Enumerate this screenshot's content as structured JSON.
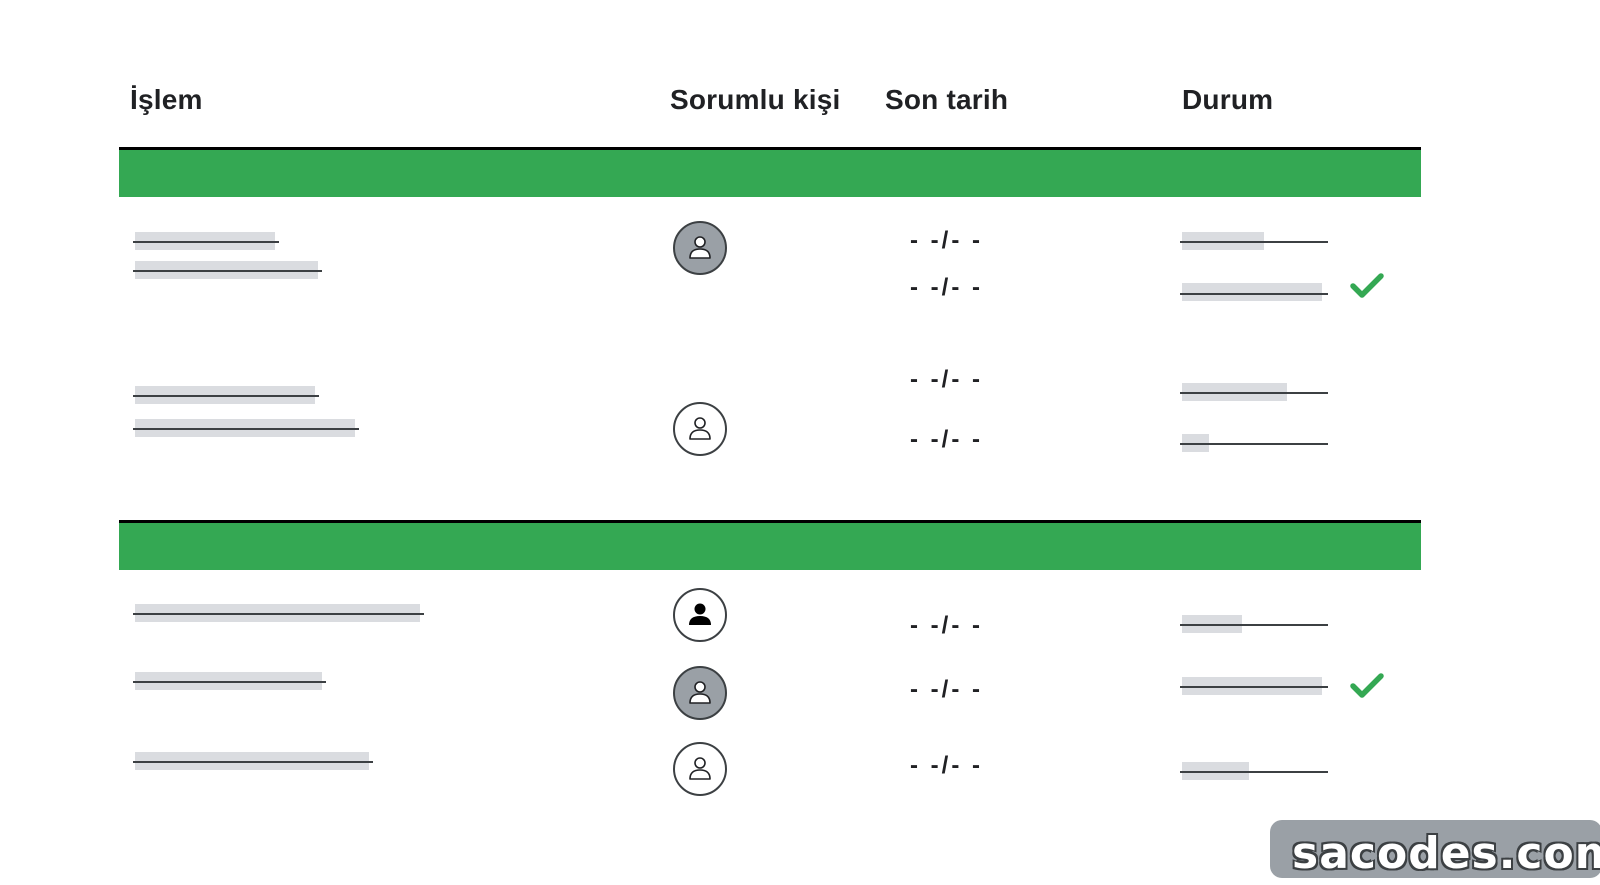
{
  "table": {
    "headers": {
      "action": "İşlem",
      "owner": "Sorumlu kişi",
      "due": "Son tarih",
      "status": "Durum"
    },
    "date_placeholder": "- -/- -"
  },
  "groups": [
    {
      "rows": [
        {
          "avatar": "person-icon",
          "avatar_style": "grey",
          "dates": [
            "- -/- -",
            "- -/- -"
          ],
          "status": [
            "in-progress",
            "done"
          ]
        },
        {
          "avatar": "person-icon",
          "avatar_style": "outline",
          "dates": [
            "- -/- -",
            "- -/- -"
          ],
          "status": [
            "in-progress",
            "in-progress"
          ]
        }
      ]
    },
    {
      "rows": [
        {
          "avatar": "person-icon",
          "avatar_style": "filled-black",
          "dates": [
            "- -/- -"
          ],
          "status": [
            "in-progress"
          ]
        },
        {
          "avatar": "person-icon",
          "avatar_style": "grey",
          "dates": [
            "- -/- -"
          ],
          "status": [
            "done"
          ]
        },
        {
          "avatar": "person-icon",
          "avatar_style": "outline",
          "dates": [
            "- -/- -"
          ],
          "status": [
            "in-progress"
          ]
        }
      ]
    }
  ],
  "colors": {
    "band": "#34a853",
    "check": "#34a853",
    "placeholder": "#dadce0",
    "avatar_grey": "#9aa0a6"
  },
  "icons": {
    "done": "check-icon",
    "owner": "person-icon"
  },
  "watermark": "sacodes.com"
}
